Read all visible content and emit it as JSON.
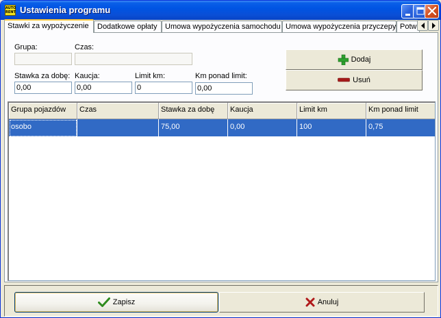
{
  "window": {
    "title": "Ustawienia programu",
    "app_icon_text": "AUTO RENT"
  },
  "tabs": [
    {
      "label": "Stawki za wypożyczenie",
      "active": true
    },
    {
      "label": "Dodatkowe opłaty",
      "active": false
    },
    {
      "label": "Umowa wypożyczenia samochodu",
      "active": false
    },
    {
      "label": "Umowa wypożyczenia przyczepy",
      "active": false
    },
    {
      "label": "Potw",
      "active": false
    }
  ],
  "form": {
    "grupa_label": "Grupa:",
    "grupa_value": "",
    "czas_label": "Czas:",
    "czas_value": "",
    "stawka_label": "Stawka za dobę:",
    "stawka_value": "0,00",
    "kaucja_label": "Kaucja:",
    "kaucja_value": "0,00",
    "limit_label": "Limit km:",
    "limit_value": "0",
    "km_ponad_label": "Km ponad limit:",
    "km_ponad_value": "0,00"
  },
  "actions": {
    "add_label": "Dodaj",
    "remove_label": "Usuń"
  },
  "table": {
    "columns": [
      "Grupa pojazdów",
      "Czas",
      "Stawka za dobę",
      "Kaucja",
      "Limit km",
      "Km ponad limit"
    ],
    "rows": [
      {
        "grupa": "osobo",
        "czas": "",
        "stawka": "75,00",
        "kaucja": "0,00",
        "limit": "100",
        "km_ponad": "0,75",
        "selected": true
      }
    ]
  },
  "footer": {
    "save_label": "Zapisz",
    "cancel_label": "Anuluj"
  },
  "colors": {
    "title_bar": "#0054e3",
    "selection": "#316ac5",
    "add_icon": "#2ea12e",
    "remove_icon": "#a61b1b",
    "save_icon": "#2e8b1e",
    "cancel_icon": "#b0191a",
    "active_tab_accent": "#ffc83c"
  },
  "icons": {
    "app": "app-logo-icon",
    "minimize": "minimize-icon",
    "maximize": "maximize-icon",
    "close": "close-icon",
    "add": "plus-icon",
    "remove": "minus-icon",
    "save": "checkmark-icon",
    "cancel": "x-icon",
    "tab_prev": "chevron-left-icon",
    "tab_next": "chevron-right-icon"
  }
}
